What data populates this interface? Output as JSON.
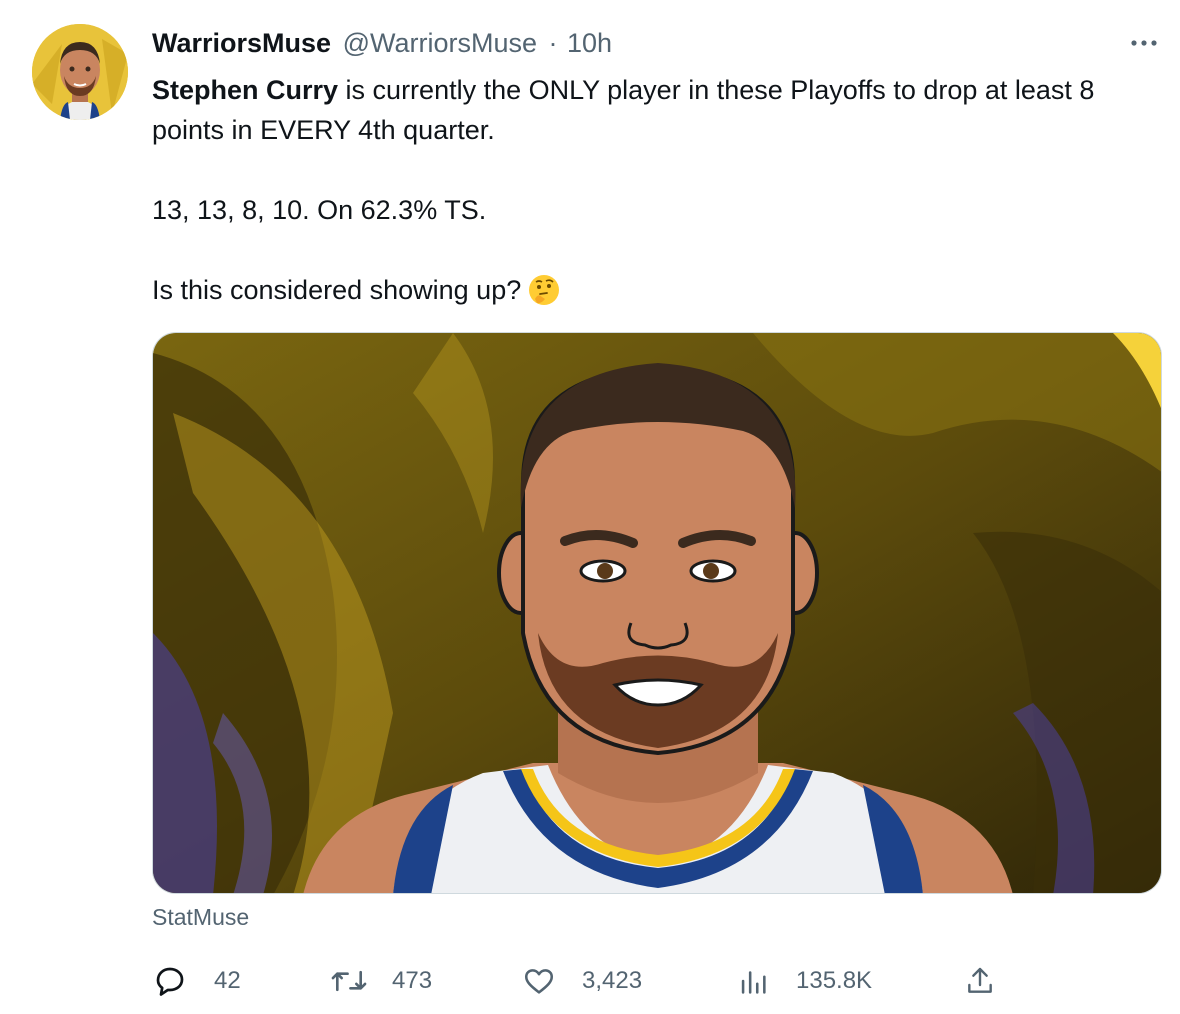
{
  "tweet": {
    "author_name": "WarriorsMuse",
    "author_handle": "@WarriorsMuse",
    "time_sep": "·",
    "time": "10h",
    "more_label": "···",
    "paragraph1_bold": "Stephen Curry",
    "paragraph1_rest": " is currently the ONLY player in these Playoffs to drop at least 8 points in EVERY 4th quarter.",
    "paragraph2": "13, 13, 8, 10. On 62.3% TS.",
    "paragraph3": "Is this considered showing up?",
    "emoji": "thinking-face",
    "media_source": "StatMuse"
  },
  "actions": {
    "replies": "42",
    "retweets": "473",
    "likes": "3,423",
    "views": "135.8K"
  },
  "colors": {
    "text": "#0f1419",
    "secondary": "#536471",
    "accent_gold": "#e8c33a",
    "jersey_blue": "#1d428a"
  },
  "icons": [
    "more-icon",
    "reply-icon",
    "retweet-icon",
    "like-icon",
    "views-icon",
    "share-icon"
  ]
}
